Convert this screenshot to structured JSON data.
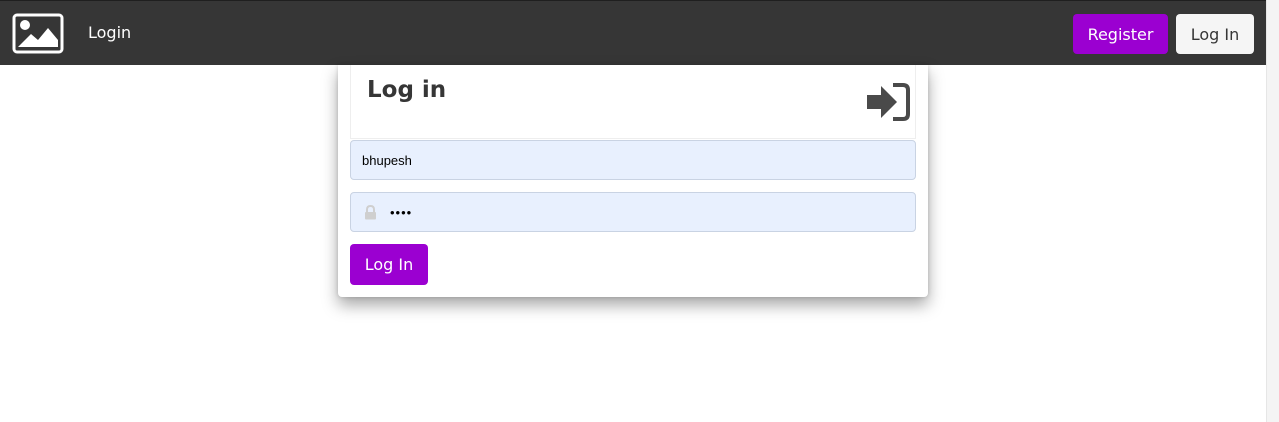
{
  "navbar": {
    "logo_icon": "image-icon",
    "link_label": "Login",
    "register_label": "Register",
    "login_label": "Log In"
  },
  "login_form": {
    "title": "Log in",
    "header_icon": "sign-in-icon",
    "username_value": "bhupesh",
    "password_value": "••••",
    "lock_icon": "lock-icon",
    "submit_label": "Log In"
  },
  "colors": {
    "navbar_bg": "#363636",
    "accent": "#9b00d1",
    "input_bg": "#e8f0fe"
  }
}
